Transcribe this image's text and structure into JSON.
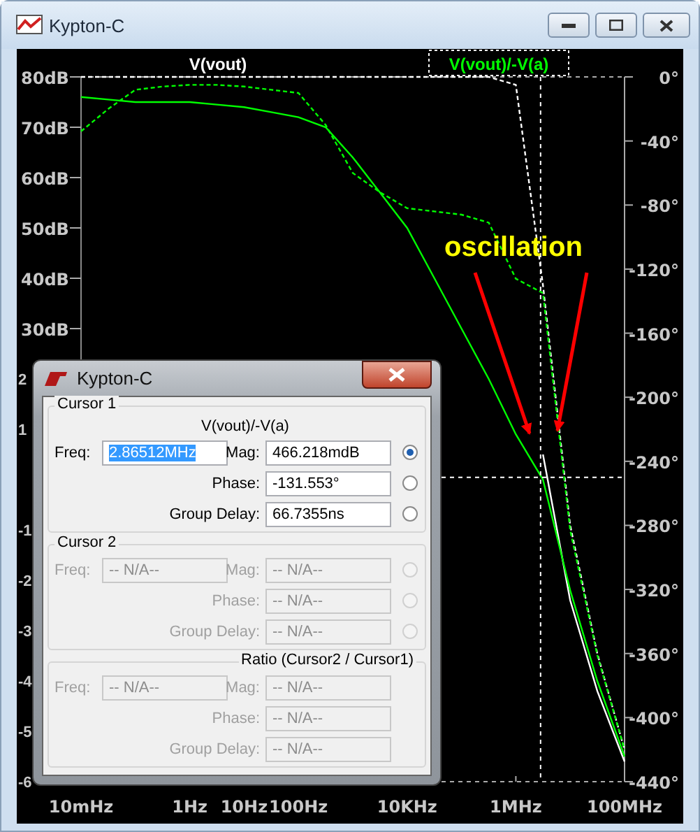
{
  "window": {
    "title": "Kypton-C"
  },
  "plot": {
    "partial_axis_labels": [
      "2",
      "1",
      "-1",
      "-2",
      "-3",
      "-4",
      "-5",
      "-6"
    ],
    "traces": [
      {
        "selected": false
      },
      {
        "selected": true
      }
    ],
    "chart_data": {
      "type": "line",
      "categories": [
        "10mHz",
        null,
        null,
        null,
        "1Hz",
        null,
        "10Hz",
        null,
        "100Hz",
        null,
        null,
        null,
        "10KHz",
        null,
        null,
        null,
        "1MHz",
        null,
        null,
        null,
        "100MHz"
      ],
      "ylim": [
        -60,
        80
      ],
      "yticks": [
        {
          "value": 80,
          "label": "80dB"
        },
        {
          "value": 70,
          "label": "70dB"
        },
        {
          "value": 60,
          "label": "60dB"
        },
        {
          "value": 50,
          "label": "50dB"
        },
        {
          "value": 40,
          "label": "40dB"
        },
        {
          "value": 30,
          "label": "30dB"
        }
      ],
      "y2lim": [
        -440,
        0
      ],
      "y2ticks": [
        {
          "value": 0,
          "label": "0°"
        },
        {
          "value": -40,
          "label": "-40°"
        },
        {
          "value": -80,
          "label": "-80°"
        },
        {
          "value": -120,
          "label": "-120°"
        },
        {
          "value": -160,
          "label": "-160°"
        },
        {
          "value": -200,
          "label": "-200°"
        },
        {
          "value": -240,
          "label": "-240°"
        },
        {
          "value": -280,
          "label": "-280°"
        },
        {
          "value": -320,
          "label": "-320°"
        },
        {
          "value": -360,
          "label": "-360°"
        },
        {
          "value": -400,
          "label": "-400°"
        },
        {
          "value": -440,
          "label": "-440°"
        }
      ],
      "series": [
        {
          "name": "V(vout)",
          "color": "#ffffff",
          "values": [
            null,
            null,
            null,
            null,
            null,
            null,
            null,
            null,
            null,
            null,
            null,
            null,
            null,
            null,
            null,
            null,
            null,
            5,
            -24,
            -42,
            -56
          ]
        },
        {
          "axis": "y2",
          "line_style": "dashed",
          "color": "#ffffff",
          "values": [
            0,
            0,
            0,
            0,
            0,
            0,
            0,
            0,
            0,
            0,
            0,
            0,
            0,
            0,
            0,
            0,
            -5,
            -130,
            -280,
            -360,
            -420
          ]
        },
        {
          "name": "V(vout)/-V(a)",
          "color": "#00ff00",
          "values": [
            76,
            75.5,
            75,
            75,
            75,
            74.5,
            74,
            73,
            72,
            70,
            64,
            57,
            50,
            40,
            30,
            20,
            9,
            0,
            -22,
            -40,
            -55
          ]
        },
        {
          "axis": "y2",
          "line_style": "dashed",
          "color": "#00ff00",
          "values": [
            -34,
            -20,
            -8,
            -6,
            -5,
            -5,
            -6,
            -8,
            -10,
            -30,
            -60,
            -72,
            -82,
            -84,
            -86,
            -91,
            -126,
            -135,
            -283,
            -361,
            -420
          ]
        }
      ],
      "ref_lines": [
        {
          "axis": "y",
          "value": 0.466
        }
      ],
      "annotations": [
        {
          "text": "oscillation"
        }
      ]
    }
  },
  "cursor_dialog": {
    "title": "Kypton-C",
    "groups": [
      {
        "kind": "cursor",
        "legend": "Cursor 1",
        "trace": "V(vout)/-V(a)",
        "disabled": false,
        "freq_label": "Freq:",
        "freq": "2.86512MHz",
        "freq_selected": true,
        "rows": [
          {
            "label": "Mag:",
            "value": "466.218mdB",
            "selected": true
          },
          {
            "label": "Phase:",
            "value": "-131.553°",
            "selected": false
          },
          {
            "label": "Group Delay:",
            "value": "66.7355ns",
            "selected": false
          }
        ]
      },
      {
        "kind": "cursor",
        "legend": "Cursor 2",
        "disabled": true,
        "freq_label": "Freq:",
        "freq": "-- N/A--",
        "freq_selected": false,
        "rows": [
          {
            "label": "Mag:",
            "value": "-- N/A--",
            "selected": false
          },
          {
            "label": "Phase:",
            "value": "-- N/A--",
            "selected": false
          },
          {
            "label": "Group Delay:",
            "value": "-- N/A--",
            "selected": false
          }
        ]
      },
      {
        "kind": "ratio",
        "legend": "Ratio (Cursor2 / Cursor1)",
        "disabled": true,
        "freq_label": "Freq:",
        "freq": "-- N/A--",
        "freq_selected": false,
        "rows": [
          {
            "label": "Mag:",
            "value": "-- N/A--"
          },
          {
            "label": "Phase:",
            "value": "-- N/A--"
          },
          {
            "label": "Group Delay:",
            "value": "-- N/A--"
          }
        ]
      }
    ]
  }
}
